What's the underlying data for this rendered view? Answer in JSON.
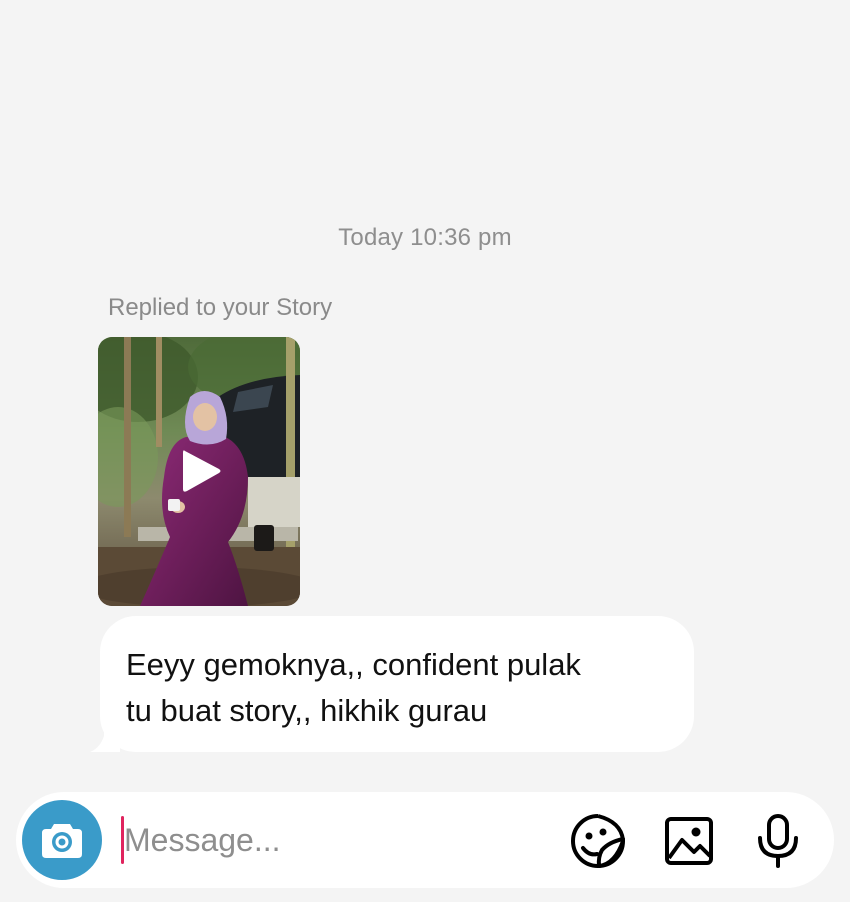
{
  "thread": {
    "timestamp": "Today 10:36 pm",
    "replied_label": "Replied to your Story",
    "message_lines": "Eeyy gemoknya,, confident pulak\ntu buat story,, hikhik gurau"
  },
  "composer": {
    "placeholder": "Message..."
  },
  "icons": {
    "camera": "camera-icon",
    "sticker": "sticker-icon",
    "gallery": "gallery-icon",
    "microphone": "microphone-icon",
    "play": "play-icon"
  },
  "colors": {
    "background": "#f4f4f4",
    "bubble": "#ffffff",
    "camera_button": "#3a9bc9",
    "caret": "#e0245e",
    "meta_text": "#8e8e8e"
  }
}
